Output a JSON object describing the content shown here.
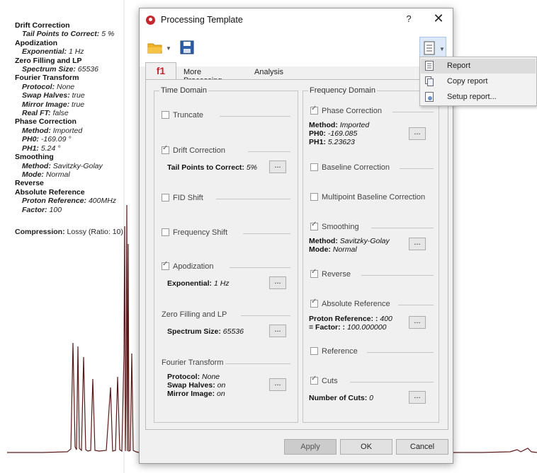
{
  "summary": {
    "sections": [
      {
        "title": "Drift Correction",
        "items": [
          {
            "k": "Tail Points to Correct:",
            "v": "5 %"
          }
        ]
      },
      {
        "title": "Apodization",
        "items": [
          {
            "k": "Exponential:",
            "v": "1 Hz"
          }
        ]
      },
      {
        "title": "Zero Filling and LP",
        "items": [
          {
            "k": "Spectrum Size:",
            "v": "65536"
          }
        ]
      },
      {
        "title": "Fourier Transform",
        "items": [
          {
            "k": "Protocol:",
            "v": "None"
          },
          {
            "k": "Swap Halves:",
            "v": "true"
          },
          {
            "k": "Mirror Image:",
            "v": "true"
          },
          {
            "k": "Real FT:",
            "v": "false"
          }
        ]
      },
      {
        "title": "Phase Correction",
        "items": [
          {
            "k": "Method:",
            "v": "Imported"
          },
          {
            "k": "PH0:",
            "v": "-169.09 °"
          },
          {
            "k": "PH1:",
            "v": "5.24 °"
          }
        ]
      },
      {
        "title": "Smoothing",
        "items": [
          {
            "k": "Method:",
            "v": "Savitzky-Golay"
          },
          {
            "k": "Mode:",
            "v": "Normal"
          }
        ]
      },
      {
        "title": "Reverse",
        "items": []
      },
      {
        "title": "Absolute Reference",
        "items": [
          {
            "k": "Proton Reference:",
            "v": "400MHz"
          },
          {
            "k": "Factor:",
            "v": "100"
          }
        ]
      }
    ],
    "compression_label": "Compression:",
    "compression_value": "Lossy (Ratio: 10)"
  },
  "dialog": {
    "title": "Processing Template",
    "help": "?",
    "close": "✕",
    "tabs": [
      "f1",
      "More Processing",
      "Analysis"
    ],
    "time_domain": {
      "title": "Time Domain",
      "truncate": "Truncate",
      "drift": "Drift Correction",
      "drift_param_k": "Tail Points to Correct:",
      "drift_param_v": "5%",
      "fid_shift": "FID Shift",
      "freq_shift": "Frequency Shift",
      "apod": "Apodization",
      "apod_k": "Exponential:",
      "apod_v": "1 Hz",
      "zf": "Zero Filling and LP",
      "zf_k": "Spectrum Size:",
      "zf_v": "65536",
      "ft": "Fourier Transform",
      "ft_protocol_k": "Protocol:",
      "ft_protocol_v": "None",
      "ft_swap_k": "Swap Halves:",
      "ft_swap_v": "on",
      "ft_mirror_k": "Mirror Image:",
      "ft_mirror_v": "on"
    },
    "freq_domain": {
      "title": "Frequency Domain",
      "phase": "Phase Correction",
      "phase_method_k": "Method:",
      "phase_method_v": "Imported",
      "ph0_k": "PH0:",
      "ph0_v": "-169.085",
      "ph1_k": "PH1:",
      "ph1_v": "5.23623",
      "baseline": "Baseline Correction",
      "multi_baseline": "Multipoint Baseline Correction",
      "smoothing": "Smoothing",
      "smooth_method_k": "Method:",
      "smooth_method_v": "Savitzky-Golay",
      "smooth_mode_k": "Mode:",
      "smooth_mode_v": "Normal",
      "reverse": "Reverse",
      "absref": "Absolute Reference",
      "proton_k": "Proton Reference: :",
      "proton_v": "400",
      "factor_k": "Factor: :",
      "factor_v": "100.000000",
      "reference": "Reference",
      "cuts": "Cuts",
      "cuts_k": "Number of Cuts:",
      "cuts_v": "0"
    },
    "dots": "...",
    "buttons": {
      "apply": "Apply",
      "ok": "OK",
      "cancel": "Cancel"
    }
  },
  "report_menu": {
    "items": [
      "Report",
      "Copy report",
      "Setup report..."
    ]
  },
  "colors": {
    "accent": "#c8262f",
    "spectrum": "#5a1a1a"
  }
}
